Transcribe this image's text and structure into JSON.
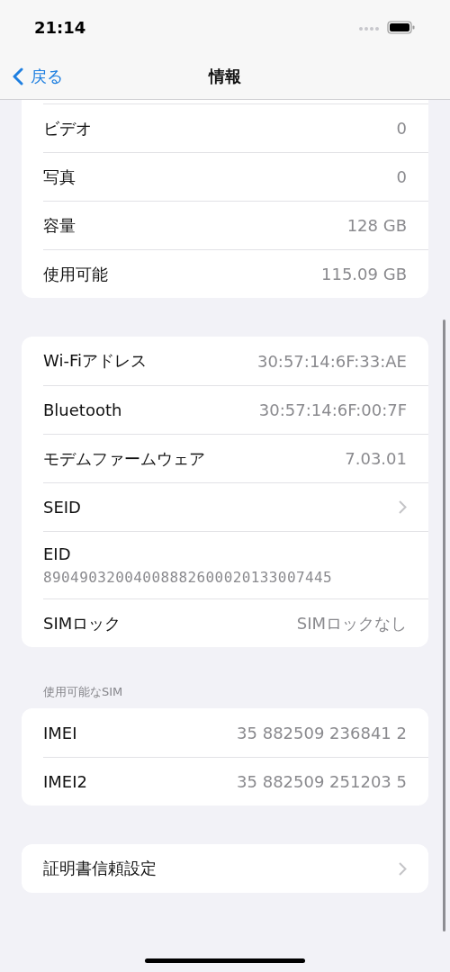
{
  "status_bar": {
    "time": "21:14"
  },
  "nav": {
    "back": "戻る",
    "title": "情報"
  },
  "sections": [
    {
      "rows": [
        {
          "kind": "value",
          "label": "ビデオ",
          "value": "0"
        },
        {
          "kind": "value",
          "label": "写真",
          "value": "0"
        },
        {
          "kind": "value",
          "label": "容量",
          "value": "128 GB"
        },
        {
          "kind": "value",
          "label": "使用可能",
          "value": "115.09 GB"
        }
      ]
    },
    {
      "rows": [
        {
          "kind": "value",
          "label": "Wi-Fiアドレス",
          "value": "30:57:14:6F:33:AE"
        },
        {
          "kind": "value",
          "label": "Bluetooth",
          "value": "30:57:14:6F:00:7F"
        },
        {
          "kind": "value",
          "label": "モデムファームウェア",
          "value": "7.03.01"
        },
        {
          "kind": "chevron",
          "label": "SEID"
        },
        {
          "kind": "stacked",
          "label": "EID",
          "value": "89049032004008882600020133007445"
        },
        {
          "kind": "value",
          "label": "SIMロック",
          "value": "SIMロックなし"
        }
      ]
    },
    {
      "header": "使用可能なSIM",
      "rows": [
        {
          "kind": "value",
          "label": "IMEI",
          "value": "35 882509 236841 2"
        },
        {
          "kind": "value",
          "label": "IMEI2",
          "value": "35 882509 251203 5"
        }
      ]
    },
    {
      "rows": [
        {
          "kind": "chevron",
          "label": "証明書信頼設定"
        }
      ]
    }
  ]
}
